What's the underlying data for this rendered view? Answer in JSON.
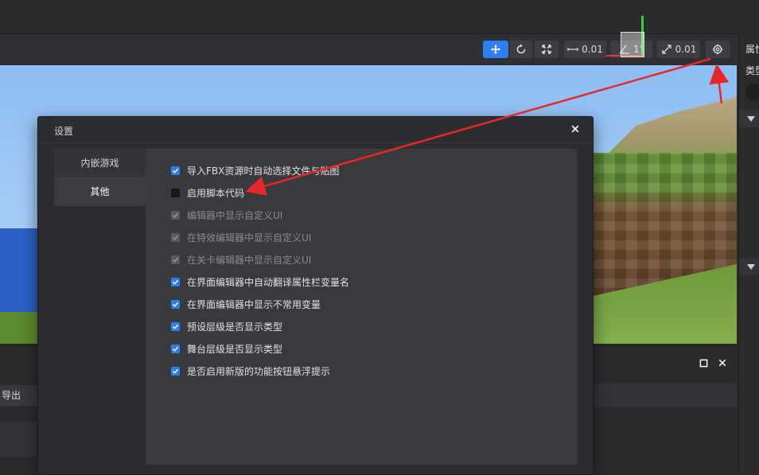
{
  "toolbar": {
    "move_value": "0.01",
    "rotate_value": "1°",
    "scale_value": "0.01"
  },
  "right_panel": {
    "label_top": "属性",
    "label_type": "类型"
  },
  "bottom": {
    "left_tab": "导出"
  },
  "dialog": {
    "title": "设置",
    "close_glyph": "✕",
    "nav": [
      {
        "label": "内嵌游戏",
        "selected": false
      },
      {
        "label": "其他",
        "selected": true
      }
    ],
    "options": [
      {
        "label": "导入FBX资源时自动选择文件与贴图",
        "state": "checked"
      },
      {
        "label": "启用脚本代码",
        "state": "unchecked"
      },
      {
        "label": "编辑器中显示自定义UI",
        "state": "disabled-checked"
      },
      {
        "label": "在特效编辑器中显示自定义UI",
        "state": "disabled-checked"
      },
      {
        "label": "在关卡编辑器中显示自定义UI",
        "state": "disabled-checked"
      },
      {
        "label": "在界面编辑器中自动翻译属性栏变量名",
        "state": "checked"
      },
      {
        "label": "在界面编辑器中显示不常用变量",
        "state": "checked"
      },
      {
        "label": "预设层级是否显示类型",
        "state": "checked"
      },
      {
        "label": "舞台层级是否显示类型",
        "state": "checked"
      },
      {
        "label": "是否启用新版的功能按钮悬浮提示",
        "state": "checked"
      }
    ]
  },
  "colors": {
    "accent": "#2d7ff0",
    "annotation_arrow": "#e8262b"
  },
  "icons": {
    "move": "move-icon",
    "rotate": "rotate-icon",
    "scale": "scale-icon",
    "settings": "gear-icon",
    "maximize": "maximize-icon",
    "close": "close-icon"
  }
}
